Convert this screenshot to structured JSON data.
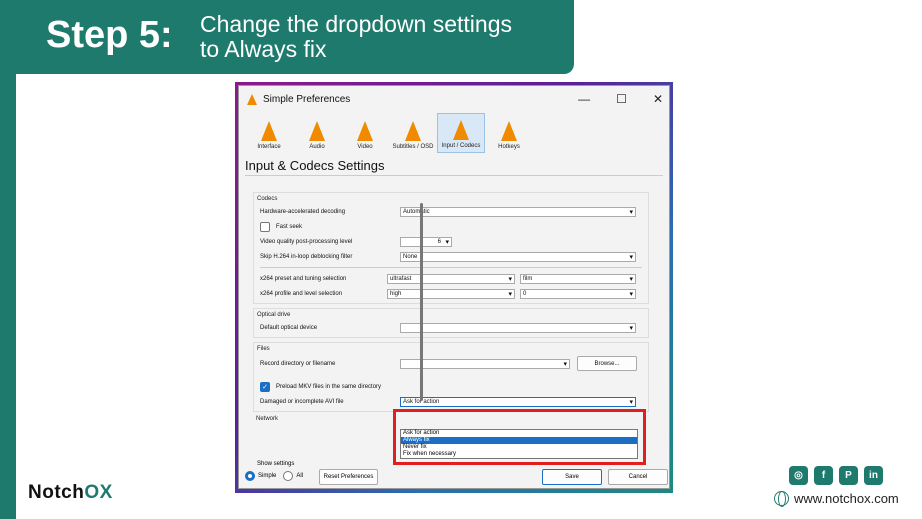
{
  "banner": {
    "step": "Step 5:",
    "description_line1": "Change the dropdown settings",
    "description_line2": "to Always fix"
  },
  "dialog": {
    "title": "Simple Preferences",
    "window_buttons": [
      "—",
      "☐",
      "✕"
    ],
    "toolbar": [
      {
        "label": "Interface",
        "active": false
      },
      {
        "label": "Audio",
        "active": false
      },
      {
        "label": "Video",
        "active": false
      },
      {
        "label": "Subtitles / OSD",
        "active": false
      },
      {
        "label": "Input / Codecs",
        "active": true
      },
      {
        "label": "Hotkeys",
        "active": false
      }
    ],
    "section_title": "Input & Codecs Settings",
    "codecs": {
      "title": "Codecs",
      "hw_label": "Hardware-accelerated decoding",
      "hw_value": "Automatic",
      "fast_seek": "Fast seek",
      "vq_label": "Video quality post-processing level",
      "vq_value": "6",
      "skip_label": "Skip H.264 in-loop deblocking filter",
      "skip_value": "None",
      "preset_label": "x264 preset and tuning selection",
      "preset_value": "ultrafast",
      "tune_value": "film",
      "profile_label": "x264 profile and level selection",
      "profile_value": "high",
      "level_value": "0"
    },
    "optical": {
      "title": "Optical drive",
      "device_label": "Default optical device",
      "device_value": ""
    },
    "files": {
      "title": "Files",
      "record_label": "Record directory or filename",
      "record_value": "",
      "browse": "Browse...",
      "preload": "Preload MKV files in the same directory",
      "avi_label": "Damaged or incomplete AVI file",
      "avi_value": "Ask for action",
      "avi_options": [
        "Ask for action",
        "Always fix",
        "Never fix",
        "Fix when necessary"
      ]
    },
    "network": {
      "title": "Network"
    },
    "footer": {
      "show_settings": "Show settings",
      "simple": "Simple",
      "all": "All",
      "reset": "Reset Preferences",
      "save": "Save",
      "cancel": "Cancel"
    }
  },
  "brand": {
    "name_part1": "Notch",
    "name_part2": "OX"
  },
  "social": [
    "◎",
    "f",
    "P",
    "in"
  ],
  "website": "www.notchox.com",
  "colors": {
    "accent": "#1e7a6d",
    "highlight": "#1a6fc4",
    "red_box": "#e02020"
  }
}
